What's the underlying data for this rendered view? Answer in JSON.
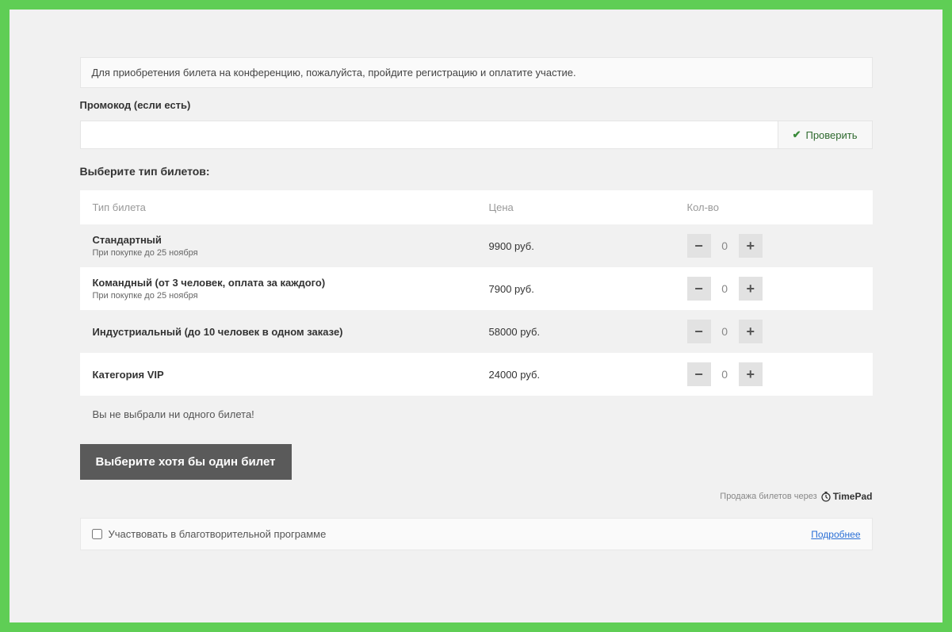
{
  "banner": "Для приобретения билета на конференцию, пожалуйста, пройдите регистрацию и оплатите участие.",
  "promo": {
    "label": "Промокод (если есть)",
    "check_label": "Проверить"
  },
  "tickets_heading": "Выберите тип билетов:",
  "columns": {
    "name": "Тип билета",
    "price": "Цена",
    "qty": "Кол-во"
  },
  "tickets": [
    {
      "name": "Стандартный",
      "sub": "При покупке до 25 ноября",
      "price": "9900 руб.",
      "qty": "0"
    },
    {
      "name": "Командный (от 3 человек, оплата за каждого)",
      "sub": "При покупке до 25 ноября",
      "price": "7900 руб.",
      "qty": "0"
    },
    {
      "name": "Индустриальный (до 10 человек в одном заказе)",
      "sub": "",
      "price": "58000 руб.",
      "qty": "0"
    },
    {
      "name": "Категория VIP",
      "sub": "",
      "price": "24000 руб.",
      "qty": "0"
    }
  ],
  "warning": "Вы не выбрали ни одного билета!",
  "submit_label": "Выберите хотя бы один билет",
  "attrib": {
    "prefix": "Продажа билетов через",
    "brand": "TimePad"
  },
  "charity": {
    "label": "Участвовать в благотворительной программе",
    "more": "Подробнее"
  }
}
